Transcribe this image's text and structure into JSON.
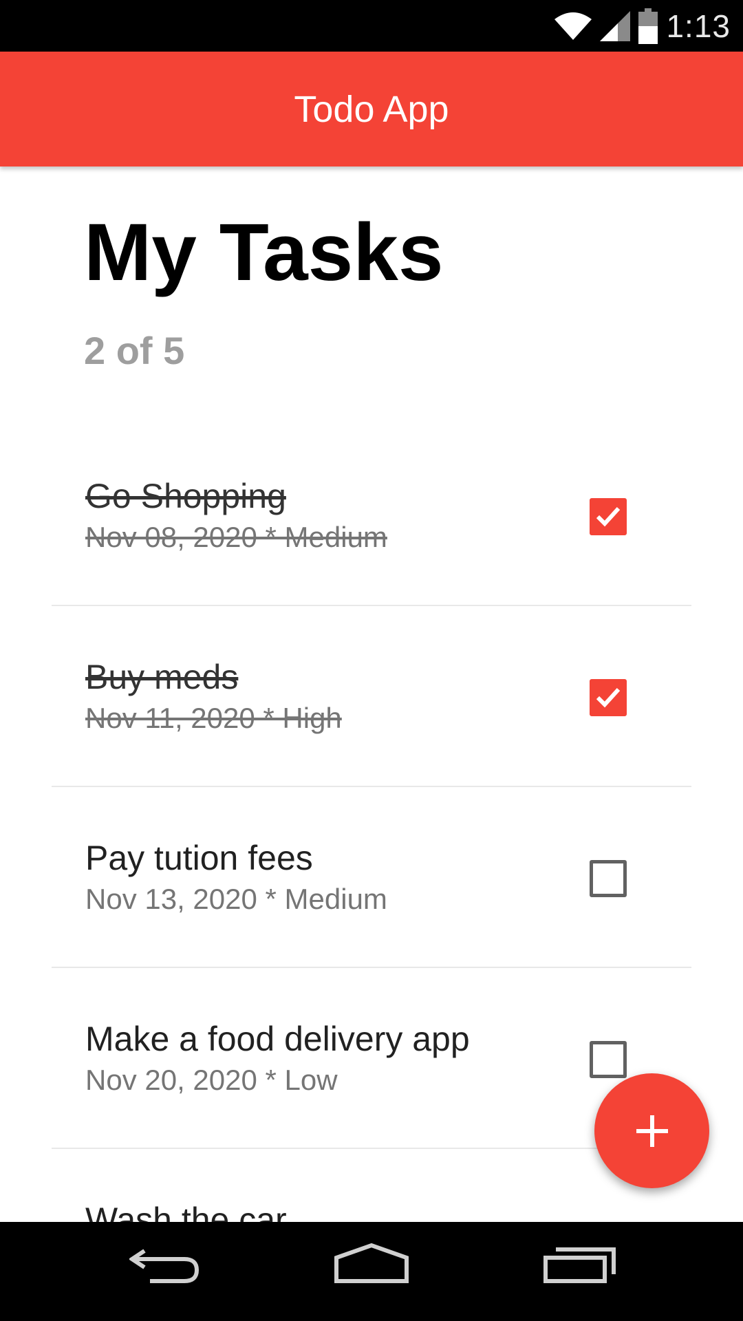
{
  "status_bar": {
    "time": "1:13",
    "icons": [
      "wifi-icon",
      "cell-signal-icon",
      "battery-icon"
    ]
  },
  "app_bar": {
    "title": "Todo App"
  },
  "header": {
    "title": "My Tasks",
    "subtitle": "2 of 5"
  },
  "tasks": [
    {
      "title": "Go Shopping",
      "meta": "Nov 08, 2020 * Medium",
      "done": true
    },
    {
      "title": "Buy meds",
      "meta": "Nov 11, 2020 * High",
      "done": true
    },
    {
      "title": "Pay tution fees",
      "meta": "Nov 13, 2020 * Medium",
      "done": false
    },
    {
      "title": "Make a food delivery app",
      "meta": "Nov 20, 2020 * Low",
      "done": false
    },
    {
      "title": "Wash the car",
      "meta": "",
      "done": false
    }
  ],
  "fab": {
    "icon": "plus-icon"
  },
  "nav_bar": {
    "icons": [
      "back-icon",
      "home-icon",
      "recents-icon"
    ]
  },
  "colors": {
    "accent": "#f44336",
    "status_bar": "#000000",
    "subtitle": "#9e9e9e"
  }
}
